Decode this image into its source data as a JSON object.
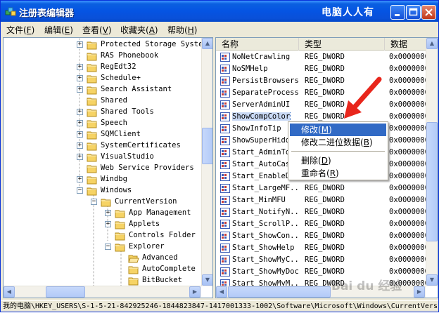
{
  "window": {
    "title": "注册表编辑器",
    "brand": "电脑人人有"
  },
  "menu": [
    {
      "label": "文件",
      "key": "F"
    },
    {
      "label": "编辑",
      "key": "E"
    },
    {
      "label": "查看",
      "key": "V"
    },
    {
      "label": "收藏夹",
      "key": "A"
    },
    {
      "label": "帮助",
      "key": "H"
    }
  ],
  "tree": [
    {
      "label": "Protected Storage System",
      "expander": "+"
    },
    {
      "label": "RAS Phonebook",
      "expander": ""
    },
    {
      "label": "RegEdt32",
      "expander": "+"
    },
    {
      "label": "Schedule+",
      "expander": "+"
    },
    {
      "label": "Search Assistant",
      "expander": "+"
    },
    {
      "label": "Shared",
      "expander": ""
    },
    {
      "label": "Shared Tools",
      "expander": "+"
    },
    {
      "label": "Speech",
      "expander": "+"
    },
    {
      "label": "SQMClient",
      "expander": "+"
    },
    {
      "label": "SystemCertificates",
      "expander": "+"
    },
    {
      "label": "VisualStudio",
      "expander": "+"
    },
    {
      "label": "Web Service Providers",
      "expander": ""
    },
    {
      "label": "Windbg",
      "expander": "+"
    },
    {
      "label": "Windows",
      "expander": "−"
    },
    {
      "label": "CurrentVersion",
      "expander": "−"
    },
    {
      "label": "App Management",
      "expander": "+"
    },
    {
      "label": "Applets",
      "expander": "+"
    },
    {
      "label": "Controls Folder",
      "expander": ""
    },
    {
      "label": "Explorer",
      "expander": "−"
    },
    {
      "label": "Advanced",
      "expander": ""
    },
    {
      "label": "AutoComplete",
      "expander": ""
    },
    {
      "label": "BitBucket",
      "expander": ""
    }
  ],
  "columns": {
    "name": "名称",
    "type": "类型",
    "data": "数据"
  },
  "values": [
    {
      "name": "NoNetCrawling",
      "type": "REG_DWORD",
      "data": "0x0000000"
    },
    {
      "name": "NoSMHelp",
      "type": "REG_DWORD",
      "data": "0x0000000"
    },
    {
      "name": "PersistBrowsers",
      "type": "REG_DWORD",
      "data": "0x0000000"
    },
    {
      "name": "SeparateProcess",
      "type": "REG_DWORD",
      "data": "0x0000000"
    },
    {
      "name": "ServerAdminUI",
      "type": "REG_DWORD",
      "data": "0x0000000"
    },
    {
      "name": "ShowCompColor",
      "type": "REG_DWORD",
      "data": "0x0000000"
    },
    {
      "name": "ShowInfoTip",
      "type": "",
      "data": "0x0000000"
    },
    {
      "name": "ShowSuperHidd",
      "type": "",
      "data": "0x0000000"
    },
    {
      "name": "Start_AdminTo",
      "type": "",
      "data": "0x0000000"
    },
    {
      "name": "Start_AutoCas",
      "type": "",
      "data": "0x0000000"
    },
    {
      "name": "Start_EnableD",
      "type": "",
      "data": "0x0000000"
    },
    {
      "name": "Start_LargeMF...",
      "type": "REG_DWORD",
      "data": "0x0000000"
    },
    {
      "name": "Start_MinMFU",
      "type": "REG_DWORD",
      "data": "0x0000000"
    },
    {
      "name": "Start_NotifyN...",
      "type": "REG_DWORD",
      "data": "0x0000000"
    },
    {
      "name": "Start_ScrollP...",
      "type": "REG_DWORD",
      "data": "0x0000000"
    },
    {
      "name": "Start_ShowCon...",
      "type": "REG_DWORD",
      "data": "0x0000000"
    },
    {
      "name": "Start_ShowHelp",
      "type": "REG_DWORD",
      "data": "0x0000000"
    },
    {
      "name": "Start_ShowMyC...",
      "type": "REG_DWORD",
      "data": "0x0000000"
    },
    {
      "name": "Start_ShowMyDocs",
      "type": "REG_DWORD",
      "data": "0x0000000"
    },
    {
      "name": "Start_ShowMyM...",
      "type": "REG_DWORD",
      "data": "0x0000000"
    }
  ],
  "context_menu": [
    {
      "label": "修改",
      "key": "M",
      "highlighted": true
    },
    {
      "label": "修改二进位数据",
      "key": "B",
      "highlighted": false
    },
    {
      "label": "删除",
      "key": "D",
      "highlighted": false
    },
    {
      "label": "重命名",
      "key": "R",
      "highlighted": false
    }
  ],
  "status": "我的电脑\\HKEY_USERS\\S-1-5-21-842925246-1844823847-1417001333-1002\\Software\\Microsoft\\Windows\\CurrentVersion\\Explorer\\Advanced",
  "watermark": "Bai du 经验",
  "colors": {
    "title_bar": "#0554e3",
    "highlight": "#316ac5",
    "annotation_arrow": "#e8261c"
  }
}
